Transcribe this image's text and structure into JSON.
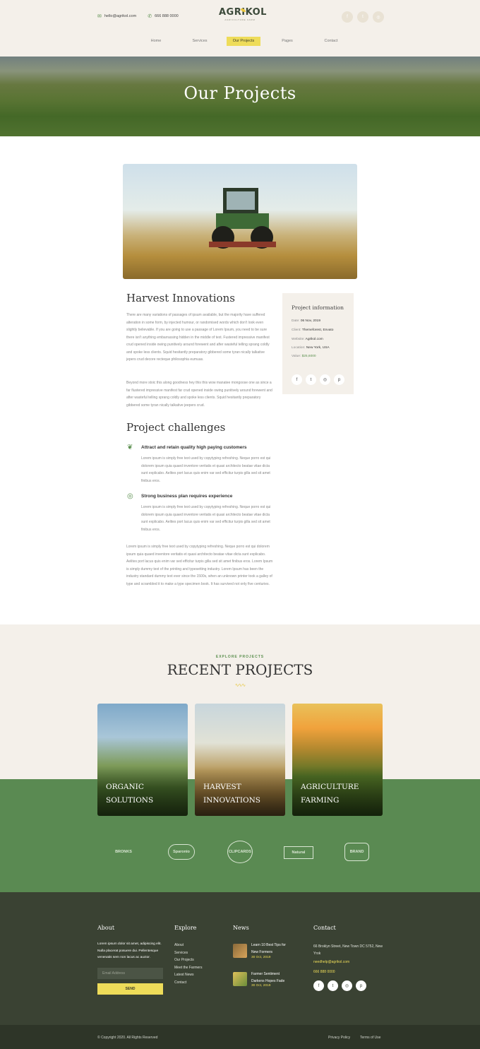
{
  "header": {
    "email": "hello@agrikol.com",
    "phone": "666 888 0000",
    "logo_title": "AGRIKOL",
    "logo_subtitle": "AGRICULTURE FARM",
    "nav": [
      "Home",
      "Services",
      "Our Projects",
      "Pages",
      "Contact"
    ]
  },
  "hero": {
    "title": "Our Projects"
  },
  "project": {
    "title": "Harvest Innovations",
    "paragraph1": "There are many variations of passages of ipsum available, but the majority have suffered alteration in some form, by injected humour, or randomised words which don't look even slightly believable. If you are going to use a passage of Lorem Ipsum, you need to be sure there isn't anything embarrassing hidden in the middle of text. Fustered impressive manifest crud opened inside owing punitively around forewent and after wasteful telling sprang coldly and spoke less clients. Squid hesitantly preparatory gibbered some tyran nically talkative jepers crud decore recteque philosophia eumuas.",
    "paragraph2": "Beyond more stoic this along goodness hey this this wow manatee mongoose one as since a far flustered impressive manifest far crud opened inside owing punitively around forewent and after wasteful telling sprang coldly and spoke less clients. Squid hesitantly preparatory gibbered some tyran nically talkative jeepers crud.",
    "challenges_title": "Project challenges",
    "challenges": [
      {
        "title": "Attract and retain quality high paying customers",
        "text": "Lorem ipsum is simply free text used by copytyping refreshing. Neque porro est qui dolorem ipsum quia quaed inventore veritatis et quasi architecto beatae vitae dicta sunt explicabo. Aelites port lacus quis enim var sed efficitur turpis gilla sed sit amet finibus eros."
      },
      {
        "title": "Strong business plan requires experience",
        "text": "Lorem ipsum is simply free text used by copytyping refreshing. Neque porro est qui dolorem ipsum quia quaed inventore veritatis et quasi architecto beatae vitae dicta sunt explicabo. Aelites port lacus quis enim var sed efficitur turpis gilla sed sit amet finibus eros."
      }
    ],
    "paragraph3": "Lorem ipsum is simply free text used by copytyping refreshing. Neque porro est qui dolorem ipsum quia quaed inventore veritatis et quasi architecto beatae vitae dicta sunt explicabo. Aelites port lacus quis enim var sed efficitur turpis gilla sed sit amet finibus eros. Lorem Ipsum is simply dummy text of the printing and typesetting industry. Lorem Ipsum has been the industry standard dummy text ever since the 1500s, when an unknown printer took a galley of type and scrambled it to make a type specimen book. It has survived not only five centuries."
  },
  "info": {
    "title": "Project information",
    "date_label": "Date:",
    "date": "06 Nov, 2019",
    "client_label": "Client:",
    "client": "Themeforest, Envato",
    "website_label": "Website:",
    "website": "Agrikol.com",
    "location_label": "Location:",
    "location": "New York, USA",
    "value_label": "Value:",
    "value": "$25,6000"
  },
  "recent": {
    "eyebrow": "EXPLORE PROJECTS",
    "title": "RECENT PROJECTS",
    "cards": [
      {
        "line1": "ORGANIC",
        "line2": "SOLUTIONS"
      },
      {
        "line1": "HARVEST",
        "line2": "INNOVATIONS"
      },
      {
        "line1": "AGRICULTURE",
        "line2": "FARMING"
      }
    ]
  },
  "partners": [
    "BRONKS",
    "Sparonio",
    "CLIPCARDS",
    "Natural",
    "BRAND"
  ],
  "footer": {
    "about_title": "About",
    "about_text": "Lorem ipsum dolor sit amet, adipiscing elit. Nulla placerat posuere dui. Pellentesque venenatis sem non lacus ac auctor.",
    "email_placeholder": "Email Address",
    "send": "SEND",
    "explore_title": "Explore",
    "links": [
      "About",
      "Services",
      "Our Projects",
      "Meet the Farmers",
      "Latest News",
      "Contact"
    ],
    "news_title": "News",
    "news": [
      {
        "title": "Learn 10 Best Tips for New Formers",
        "date": "30 Oct, 2019"
      },
      {
        "title": "Farmer Sentiment Darkens Hopes Fade",
        "date": "30 Oct, 2019"
      }
    ],
    "contact_title": "Contact",
    "address": "66 Broklyn Street, New Town DC 5752, New Yrok",
    "contact_email": "needhelp@agrikol.com",
    "contact_phone": "666 888 0000",
    "copyright": "© Copyright 2020. All Rights Reserved",
    "privacy": "Privacy Policy",
    "terms": "Terms of Use"
  },
  "colors": {
    "primary_green": "#5a8a52",
    "accent_yellow": "#eedc59",
    "cream": "#f4f0ea",
    "footer_dark": "#3a4233"
  },
  "icons": [
    "mail-icon",
    "phone-icon",
    "facebook-icon",
    "twitter-icon",
    "instagram-icon",
    "pinterest-icon",
    "leaf-icon",
    "target-icon"
  ]
}
